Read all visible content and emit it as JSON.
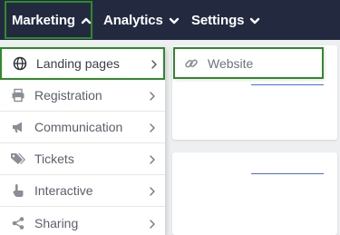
{
  "nav": {
    "items": [
      {
        "label": "Marketing",
        "icon": "chevron-up-icon"
      },
      {
        "label": "Analytics",
        "icon": "chevron-down-icon"
      },
      {
        "label": "Settings",
        "icon": "chevron-down-icon"
      }
    ]
  },
  "menu": {
    "items": [
      {
        "label": "Landing pages",
        "icon": "globe-icon"
      },
      {
        "label": "Registration",
        "icon": "printer-icon"
      },
      {
        "label": "Communication",
        "icon": "megaphone-icon"
      },
      {
        "label": "Tickets",
        "icon": "tags-icon"
      },
      {
        "label": "Interactive",
        "icon": "pointer-hand-icon"
      },
      {
        "label": "Sharing",
        "icon": "share-icon"
      }
    ]
  },
  "submenu": {
    "items": [
      {
        "label": "Website",
        "icon": "link-icon"
      }
    ]
  },
  "colors": {
    "topbar": "#232a40",
    "highlight_border": "#2f8a2a",
    "accent_line": "#4b6bd6"
  }
}
